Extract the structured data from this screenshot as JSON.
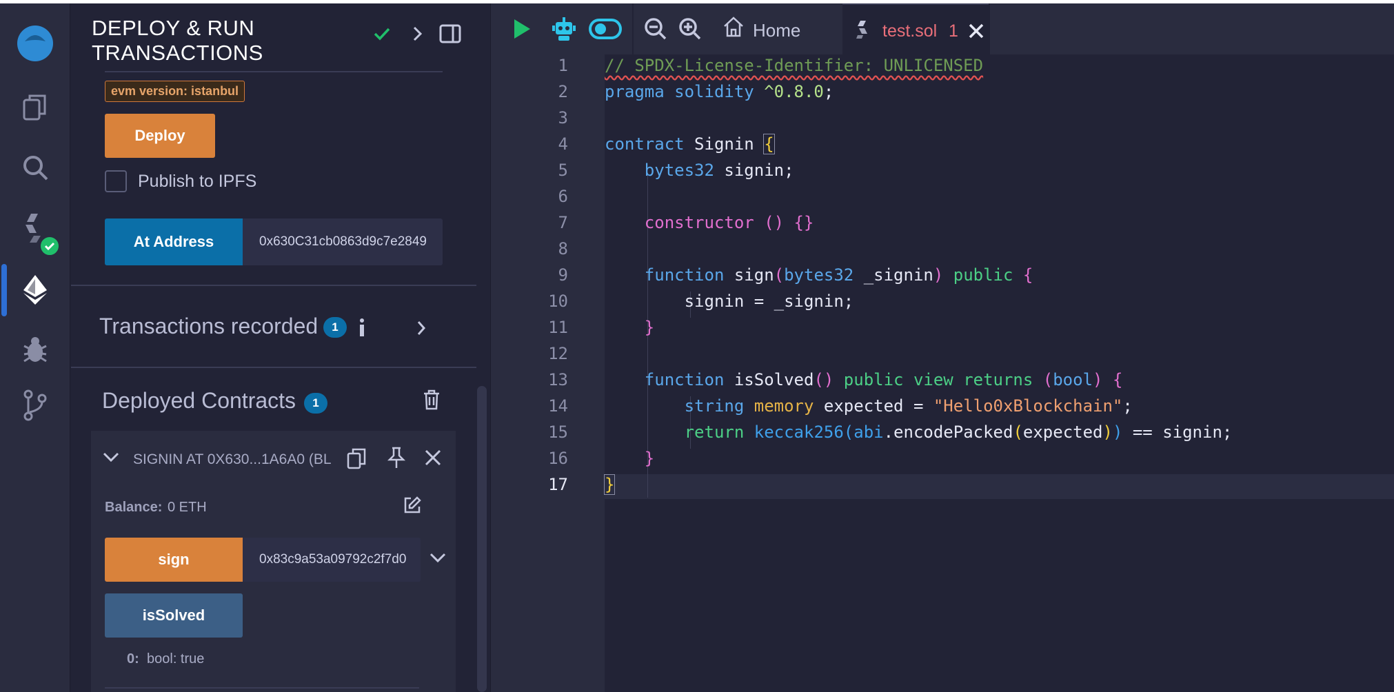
{
  "panel": {
    "title": "DEPLOY & RUN\nTRANSACTIONS",
    "evm_tag": "evm version: istanbul",
    "deploy_label": "Deploy",
    "publish_label": "Publish to IPFS",
    "at_address_label": "At Address",
    "at_address_value": "0x630C31cb0863d9c7e2849",
    "transactions_label": "Transactions recorded",
    "transactions_count": "1",
    "deployed_label": "Deployed Contracts",
    "deployed_count": "1",
    "contract": {
      "title": "SIGNIN AT 0X630...1A6A0 (BL",
      "balance_label": "Balance:",
      "balance_value": "0 ETH",
      "sign_label": "sign",
      "sign_value": "0x83c9a53a09792c2f7d0",
      "issolved_label": "isSolved",
      "result_key": "0:",
      "result_value": "bool: true"
    }
  },
  "editor": {
    "home_tab": "Home",
    "file_tab": "test.sol",
    "file_tab_problems": "1",
    "line_numbers": [
      "1",
      "2",
      "3",
      "4",
      "5",
      "6",
      "7",
      "8",
      "9",
      "10",
      "11",
      "12",
      "13",
      "14",
      "15",
      "16",
      "17"
    ],
    "active_line": "17",
    "code": {
      "l1": "// SPDX-License-Identifier: UNLICENSED",
      "l2a": "pragma solidity ",
      "l2b": "^0.8.0",
      "l2c": ";",
      "l4a": "contract ",
      "l4b": "Signin ",
      "l4c": "{",
      "l5a": "    bytes32",
      "l5b": " signin;",
      "l7a": "    constructor ",
      "l7b": "() ",
      "l7c": "{}",
      "l9a": "    function ",
      "l9b": "sign",
      "l9c": "(",
      "l9d": "bytes32",
      "l9e": " _signin",
      "l9f": ") ",
      "l9g": "public ",
      "l9h": "{",
      "l10": "        signin = _signin;",
      "l11": "    }",
      "l13a": "    function ",
      "l13b": "isSolved",
      "l13c": "() ",
      "l13d": "public view returns ",
      "l13e": "(",
      "l13f": "bool",
      "l13g": ") ",
      "l13h": "{",
      "l14a": "        string ",
      "l14b": "memory",
      "l14c": " expected = ",
      "l14d": "\"Hello0xBlockchain\"",
      "l14e": ";",
      "l15a": "        return ",
      "l15b": "keccak256",
      "l15c": "(",
      "l15d": "abi",
      "l15e": ".encodePacked",
      "l15f": "(",
      "l15g": "expected",
      "l15h": ")",
      "l15i": ")",
      "l15j": " == signin;",
      "l16": "    }",
      "l17": "}"
    }
  },
  "colors": {
    "accent_orange": "#d9823b",
    "accent_blue": "#0b6fa8",
    "check_green": "#20bf6b"
  }
}
